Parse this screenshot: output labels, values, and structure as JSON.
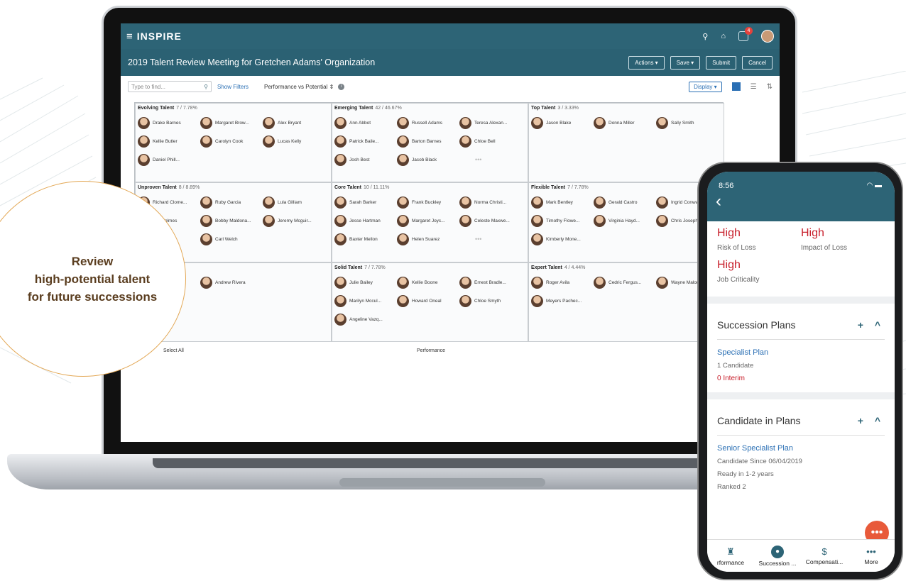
{
  "laptop": {
    "brand": "INSPIRE",
    "title": "2019 Talent Review Meeting for Gretchen Adams' Organization",
    "notif_count": "4",
    "buttons": {
      "actions": "Actions ▾",
      "save": "Save ▾",
      "submit": "Submit",
      "cancel": "Cancel"
    },
    "toolbar": {
      "search_placeholder": "Type to find...",
      "show_filters": "Show Filters",
      "view_select": "Performance vs Potential ⇕",
      "display": "Display ▾"
    },
    "boxes": [
      {
        "title": "Evolving Talent",
        "count": "7 / 7.78%",
        "people": [
          "Drake Barnes",
          "Margaret Brow...",
          "Alex Bryant",
          "Kellie Butler",
          "Carolyn Cook",
          "Lucas Kelly",
          "Daniel Phill..."
        ],
        "more": false
      },
      {
        "title": "Emerging Talent",
        "count": "42 / 46.67%",
        "people": [
          "Ann Abbot",
          "Russell Adams",
          "Teresa Alexan...",
          "Patrick Baile...",
          "Barton Barnes",
          "Chloe Bell",
          "Josh Best",
          "Jacob Black"
        ],
        "more": true
      },
      {
        "title": "Top Talent",
        "count": "3 / 3.33%",
        "people": [
          "Jason Blake",
          "Donna Miller",
          "Sally Smith"
        ],
        "more": false
      },
      {
        "title": "Unproven Talent",
        "count": "8 / 8.89%",
        "people": [
          "Richard Clome...",
          "Ruby Garcia",
          "Lula Gilliam",
          "...ie Holmes",
          "Bobby Maldona...",
          "Jeremy Mcguir...",
          "...bles",
          "Carl Welch"
        ],
        "more": false
      },
      {
        "title": "Core Talent",
        "count": "10 / 11.11%",
        "people": [
          "Sarah Barker",
          "Frank Buckley",
          "Norma Christi...",
          "Jesse Hartman",
          "Margaret Joyc...",
          "Celeste Maxwe...",
          "Baxter Mellon",
          "Helen Suarez"
        ],
        "more": true
      },
      {
        "title": "Flexible Talent",
        "count": "7 / 7.78%",
        "people": [
          "Mark Bentley",
          "Gerald Castro",
          "Ingrid Conway",
          "Timothy Flowe...",
          "Virginia Hayd...",
          "Chris Joseph",
          "Kimberly Mone..."
        ],
        "more": false
      },
      {
        "title": "",
        "count": "/ 2.22%",
        "people": [
          "",
          "Andrew Rivera"
        ],
        "more": false
      },
      {
        "title": "Solid Talent",
        "count": "7 / 7.78%",
        "people": [
          "Julie Bailey",
          "Kellie Boone",
          "Ernest Bradle...",
          "Marilyn Mccul...",
          "Howard Oneal",
          "Chloe Smyth",
          "Angeline Vazq..."
        ],
        "more": false
      },
      {
        "title": "Expert Talent",
        "count": "4 / 4.44%",
        "people": [
          "Roger Avila",
          "Cedric Fergus...",
          "Wayne Malone",
          "Meyers Pachec..."
        ],
        "more": false
      }
    ],
    "select_all": "Select All",
    "x_axis_label": "Performance"
  },
  "callout": {
    "line1": "Review",
    "line2": "high-potential talent",
    "line3": "for future successions"
  },
  "phone": {
    "time": "8:56",
    "risk_of_loss_value": "High",
    "risk_of_loss_label": "Risk of Loss",
    "impact_value": "High",
    "impact_label": "Impact of Loss",
    "criticality_value": "High",
    "criticality_label": "Job Criticality",
    "succession_title": "Succession Plans",
    "plan_name": "Specialist Plan",
    "plan_candidates": "1 Candidate",
    "plan_interim": "0 Interim",
    "candidate_title": "Candidate in Plans",
    "cand_plan_name": "Senior Specialist Plan",
    "cand_since": "Candidate Since 06/04/2019",
    "cand_ready": "Ready in 1-2 years",
    "cand_rank": "Ranked 2",
    "nav": [
      "rformance",
      "Succession ...",
      "Compensati...",
      "More"
    ]
  },
  "colors": {
    "header": "#2d6476",
    "accent": "#2a6fb4",
    "alert": "#c8202c",
    "callout_border": "#e3a856"
  }
}
